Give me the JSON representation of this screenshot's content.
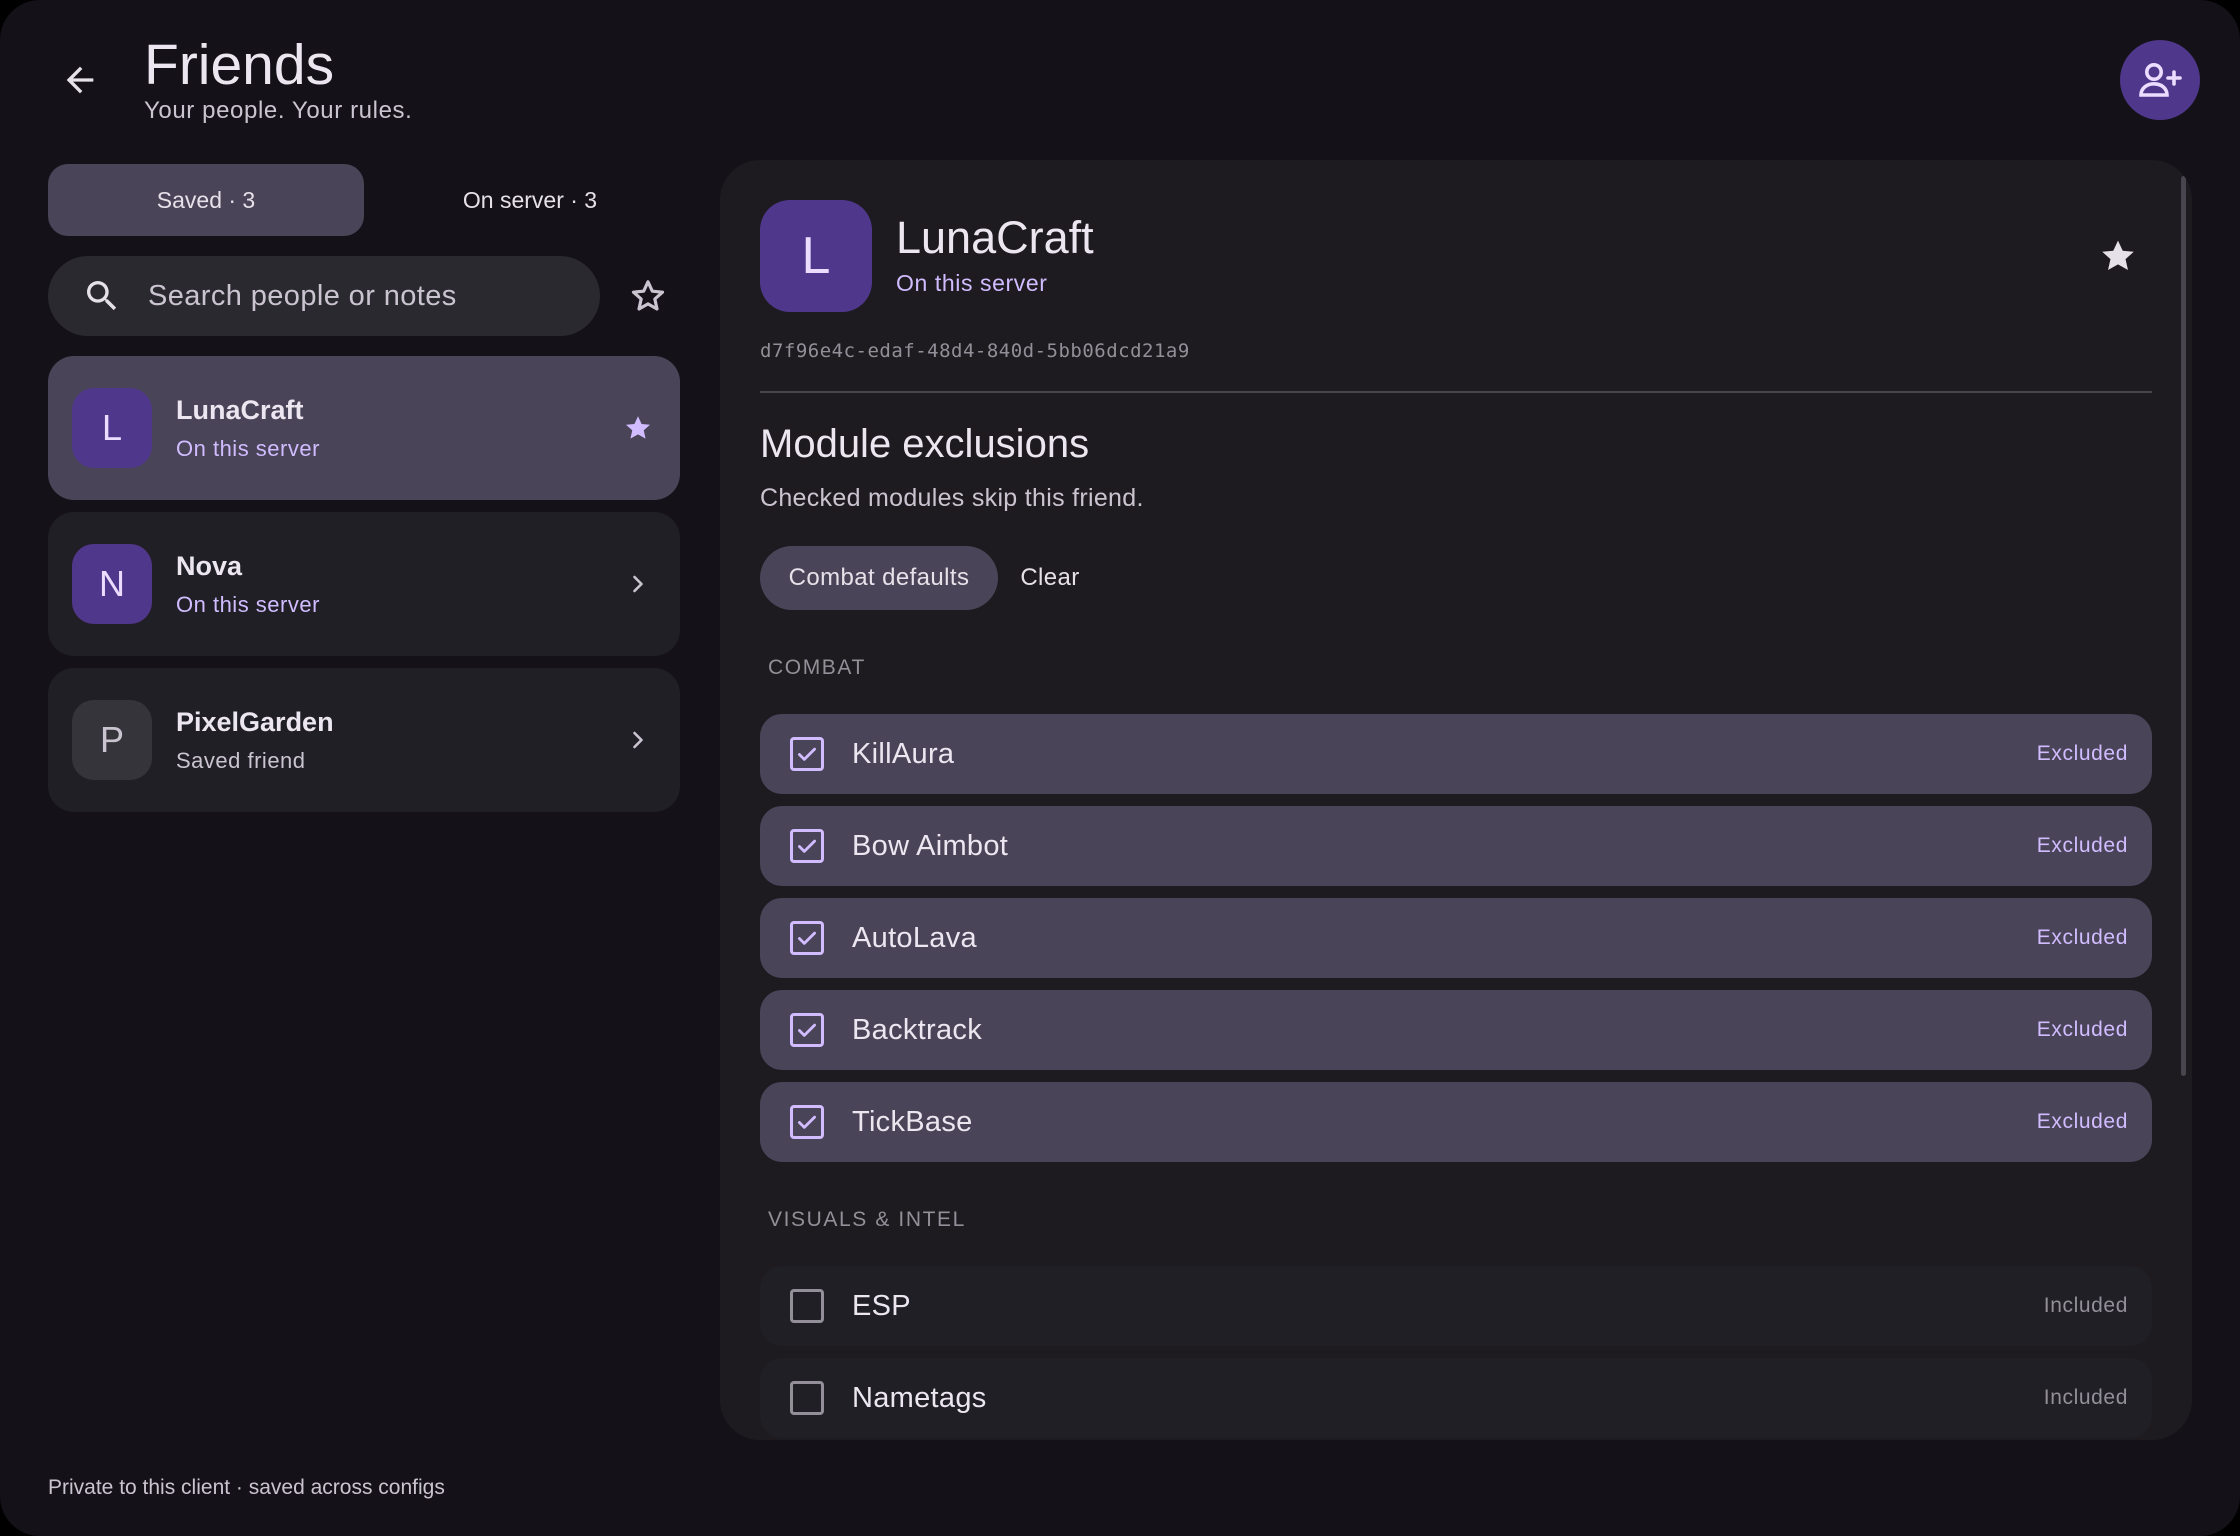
{
  "header": {
    "title": "Friends",
    "subtitle": "Your people. Your rules."
  },
  "tabs": [
    {
      "label": "Saved · 3",
      "active": true
    },
    {
      "label": "On server · 3",
      "active": false
    }
  ],
  "search": {
    "placeholder": "Search people or notes"
  },
  "friends": [
    {
      "initial": "L",
      "name": "LunaCraft",
      "status": "On this server",
      "selected": true,
      "favorite": true
    },
    {
      "initial": "N",
      "name": "Nova",
      "status": "On this server",
      "selected": false,
      "favorite": false
    },
    {
      "initial": "P",
      "name": "PixelGarden",
      "status": "Saved friend",
      "selected": false,
      "favorite": false
    }
  ],
  "footer": {
    "note": "Private to this client · saved across configs"
  },
  "detail": {
    "initial": "L",
    "name": "LunaCraft",
    "status": "On this server",
    "uuid": "d7f96e4c-edaf-48d4-840d-5bb06dcd21a9",
    "section_title": "Module exclusions",
    "section_desc": "Checked modules skip this friend.",
    "chips": {
      "defaults": "Combat defaults",
      "clear": "Clear"
    },
    "groups": [
      {
        "label": "COMBAT",
        "modules": [
          {
            "name": "KillAura",
            "checked": true,
            "state": "Excluded"
          },
          {
            "name": "Bow Aimbot",
            "checked": true,
            "state": "Excluded"
          },
          {
            "name": "AutoLava",
            "checked": true,
            "state": "Excluded"
          },
          {
            "name": "Backtrack",
            "checked": true,
            "state": "Excluded"
          },
          {
            "name": "TickBase",
            "checked": true,
            "state": "Excluded"
          }
        ]
      },
      {
        "label": "VISUALS & INTEL",
        "modules": [
          {
            "name": "ESP",
            "checked": false,
            "state": "Included"
          },
          {
            "name": "Nametags",
            "checked": false,
            "state": "Included"
          }
        ]
      }
    ]
  },
  "colors": {
    "background": "#141218",
    "surface": "#1D1B20",
    "selected": "#4A4458",
    "accent": "#D0BCFF",
    "avatar": "#4F378B"
  }
}
